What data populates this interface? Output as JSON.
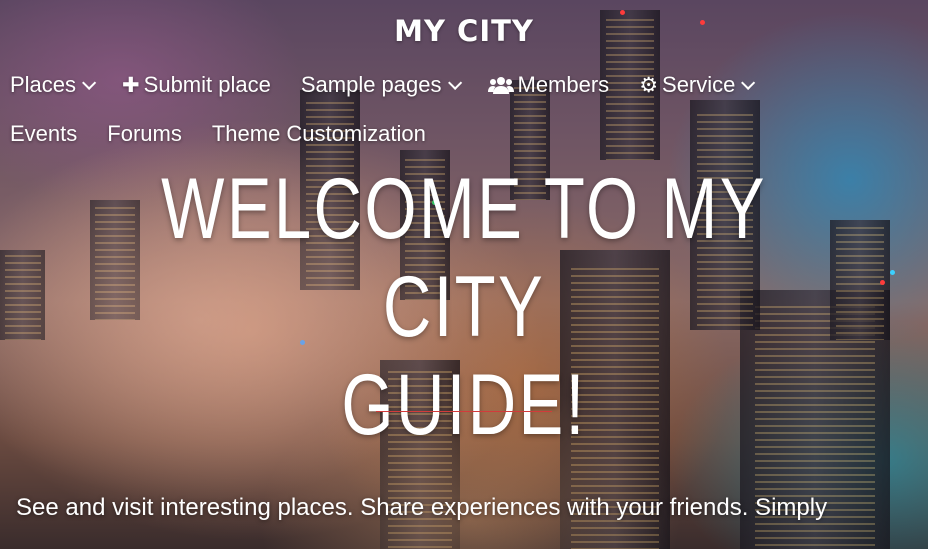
{
  "site": {
    "title": "MY CITY"
  },
  "nav": {
    "row1": [
      {
        "label": "Places",
        "icon": "",
        "has_dropdown": true
      },
      {
        "label": "Submit place",
        "icon": "plus-icon",
        "has_dropdown": false
      },
      {
        "label": "Sample pages",
        "icon": "",
        "has_dropdown": true
      },
      {
        "label": "Members",
        "icon": "users-icon",
        "has_dropdown": false
      },
      {
        "label": "Service",
        "icon": "cogs-icon",
        "has_dropdown": true
      }
    ],
    "row2": [
      {
        "label": "Events"
      },
      {
        "label": "Forums"
      },
      {
        "label": "Theme Customization"
      }
    ]
  },
  "hero": {
    "heading_line1": "WELCOME TO MY CITY",
    "heading_line2": "GUIDE!",
    "tagline": "See and visit interesting places. Share experiences with your friends. Simply",
    "divider_color": "#d23b3b"
  }
}
